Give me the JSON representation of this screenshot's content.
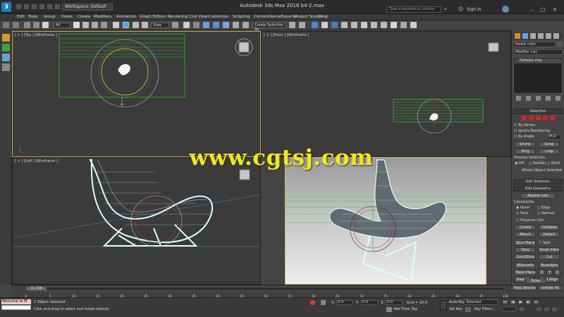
{
  "app": {
    "title": "Autodesk 3ds Max 2016    b4-2.max",
    "workspace": "Workspace: Default",
    "search_placeholder": "Type a keyword or phrase",
    "signin": "Sign In"
  },
  "menu": [
    "Edit",
    "Tools",
    "Group",
    "Views",
    "Create",
    "Modifiers",
    "Animation",
    "Graph Editors",
    "Rendering",
    "Civil View",
    "Customize",
    "Scripting",
    "Content",
    "GameExporter",
    "Project Studio",
    "Help"
  ],
  "toolbar": {
    "selection_filter": "All",
    "ref_coord": "View",
    "named_selection": "Create Selection Se"
  },
  "viewports": {
    "top": "[ + ] [Top ] [Wireframe ]",
    "front": "[ + ] [Front ] [Wireframe ]",
    "left": "[ + ] [Left ] [Wireframe ]",
    "perspective": ""
  },
  "watermark": "www.cgtsj.com",
  "command_panel": {
    "object_name": "lhoste chair",
    "modifier_list": "Modifier List",
    "stack_item": "Editable Poly",
    "selection_title": "Selection",
    "by_vertex": "By Vertex",
    "ignore_backfacing": "Ignore Backfacing",
    "by_angle": "By Angle:",
    "angle_value": "45.0",
    "shrink": "Shrink",
    "grow": "Grow",
    "ring": "Ring",
    "loop": "Loop",
    "preview_selection": "Preview Selection",
    "preview_off": "Off",
    "preview_subobj": "SubObj",
    "preview_multi": "Multi",
    "selected_info": "Whole Object Selected",
    "soft_selection": "Soft Selection",
    "edit_geometry": "Edit Geometry",
    "repeat_last": "Repeat Last",
    "constraints": "Constraints",
    "c_none": "None",
    "c_edge": "Edge",
    "c_face": "Face",
    "c_normal": "Normal",
    "preserve_uvs": "Preserve UVs",
    "create": "Create",
    "collapse": "Collapse",
    "attach": "Attach",
    "detach": "Detach",
    "slice_plane": "Slice Plane",
    "split": "Split",
    "slice": "Slice",
    "reset_plane": "Reset Plane",
    "quickslice": "QuickSlice",
    "cut": "Cut",
    "msmooth": "MSmooth",
    "tessellate": "Tessellate",
    "make_planar": "Make Planar",
    "x": "X",
    "y": "Y",
    "z": "Z",
    "view_align": "View Align",
    "grid_align": "Grid Align",
    "relax": "Relax",
    "hide_selected": "Hide Selected",
    "unhide_all": "Unhide All"
  },
  "timeline": {
    "frame_counter": "0 / 100",
    "ticks": [
      "0",
      "5",
      "10",
      "15",
      "20",
      "25",
      "30",
      "35",
      "40",
      "45",
      "50",
      "55",
      "60",
      "65",
      "70",
      "75",
      "80",
      "85",
      "90",
      "95",
      "100"
    ]
  },
  "status": {
    "listener": "Welcome to M",
    "object_selected": "1 Object Selected",
    "prompt": "Click and drag to select and rotate objects",
    "x_label": "X:",
    "x_value": "0.0",
    "y_label": "Y:",
    "y_value": "0.0",
    "z_label": "Z:",
    "z_value": "0.0",
    "grid": "Grid = 10.0",
    "add_time_tag": "Add Time Tag",
    "auto_key": "Auto Key",
    "selected": "Selected",
    "set_key": "Set Key",
    "key_filters": "Key Filters..."
  }
}
